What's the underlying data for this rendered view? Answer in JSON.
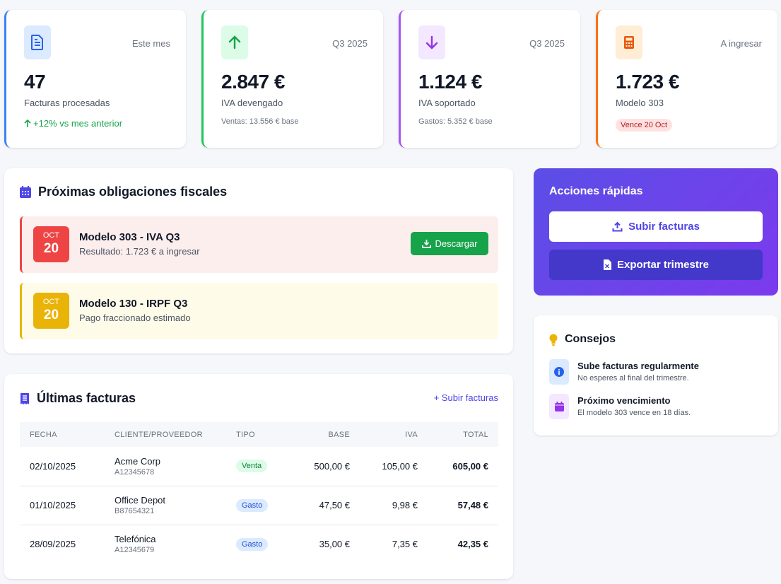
{
  "stats": [
    {
      "tag": "Este mes",
      "value": "47",
      "label": "Facturas procesadas",
      "trend": "+12% vs mes anterior",
      "icon": "document-icon",
      "accent": "#3b82f6"
    },
    {
      "tag": "Q3 2025",
      "value": "2.847 €",
      "label": "IVA devengado",
      "sub": "Ventas: 13.556 € base",
      "icon": "arrow-up-icon",
      "accent": "#22c55e"
    },
    {
      "tag": "Q3 2025",
      "value": "1.124 €",
      "label": "IVA soportado",
      "sub": "Gastos: 5.352 € base",
      "icon": "arrow-down-icon",
      "accent": "#a855f7"
    },
    {
      "tag": "A ingresar",
      "value": "1.723 €",
      "label": "Modelo 303",
      "badge": "Vence 20 Oct",
      "icon": "calculator-icon",
      "accent": "#f97316"
    }
  ],
  "obligations": {
    "title": "Próximas obligaciones fiscales",
    "items": [
      {
        "month": "OCT",
        "day": "20",
        "title": "Modelo 303 - IVA Q3",
        "desc": "Resultado: 1.723 € a ingresar",
        "button": "Descargar"
      },
      {
        "month": "OCT",
        "day": "20",
        "title": "Modelo 130 - IRPF Q3",
        "desc": "Pago fraccionado estimado"
      }
    ]
  },
  "invoices": {
    "title": "Últimas facturas",
    "upload_link": "+ Subir facturas",
    "columns": [
      "FECHA",
      "CLIENTE/PROVEEDOR",
      "TIPO",
      "BASE",
      "IVA",
      "TOTAL"
    ],
    "rows": [
      {
        "date": "02/10/2025",
        "client": "Acme Corp",
        "id": "A12345678",
        "type": "Venta",
        "base": "500,00 €",
        "iva": "105,00 €",
        "total": "605,00 €"
      },
      {
        "date": "01/10/2025",
        "client": "Office Depot",
        "id": "B87654321",
        "type": "Gasto",
        "base": "47,50 €",
        "iva": "9,98 €",
        "total": "57,48 €"
      },
      {
        "date": "28/09/2025",
        "client": "Telefónica",
        "id": "A12345679",
        "type": "Gasto",
        "base": "35,00 €",
        "iva": "7,35 €",
        "total": "42,35 €"
      }
    ]
  },
  "quick_actions": {
    "title": "Acciones rápidas",
    "upload": "Subir facturas",
    "export": "Exportar trimestre"
  },
  "tips": {
    "title": "Consejos",
    "items": [
      {
        "title": "Sube facturas regularmente",
        "desc": "No esperes al final del trimestre."
      },
      {
        "title": "Próximo vencimiento",
        "desc": "El modelo 303 vence en 18 días."
      }
    ]
  }
}
